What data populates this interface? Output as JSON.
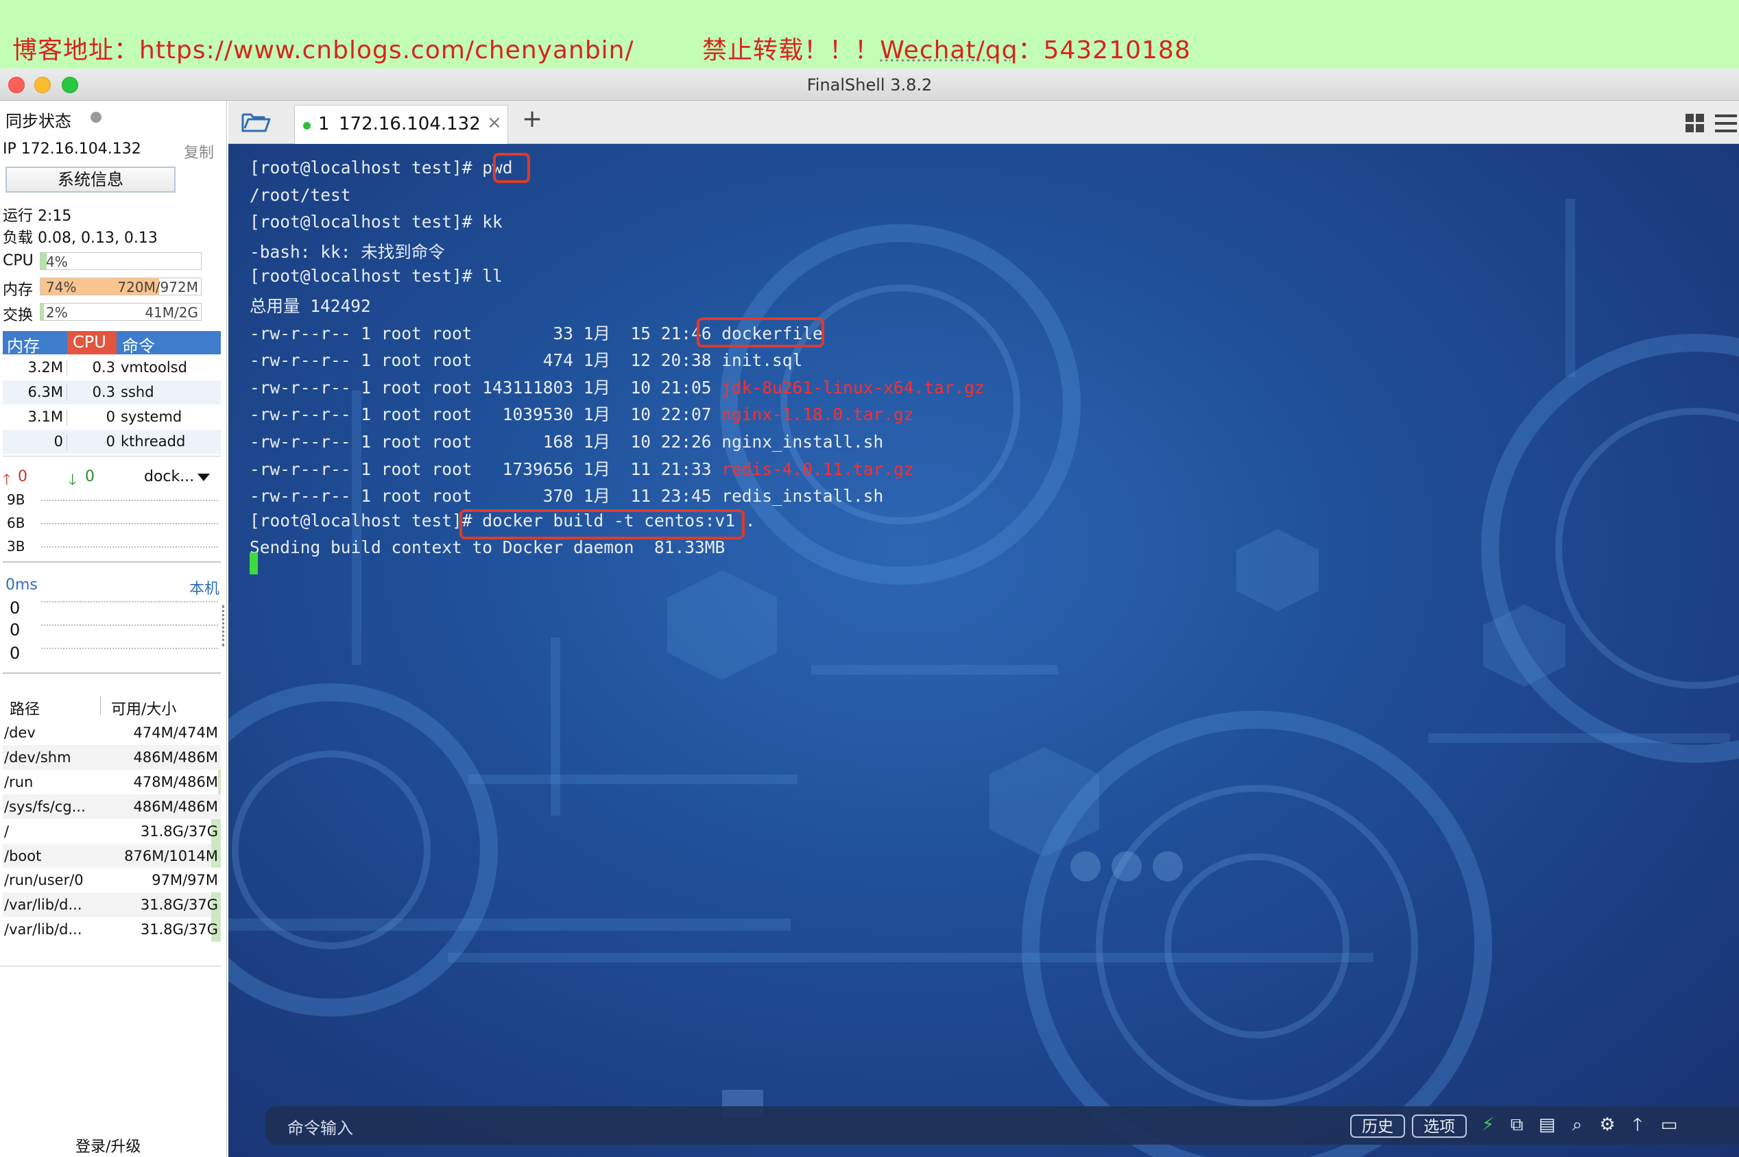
{
  "banner": {
    "prefix": "博客地址：https://www.cnblogs.com/chenyanbin/",
    "gap": "        ",
    "notice": "禁止转载！！！",
    "contact_label": "Wechat/qq",
    "contact_value": "：543210188"
  },
  "window": {
    "title": "FinalShell 3.8.2"
  },
  "sidebar": {
    "sync_label": "同步状态",
    "ip_label": "IP 172.16.104.132",
    "copy_label": "复制",
    "sysinfo_button": "系统信息",
    "uptime": "运行 2:15",
    "load": "负载 0.08, 0.13, 0.13",
    "cpu": {
      "label": "CPU",
      "text": "4%",
      "fraction": 0.04
    },
    "mem": {
      "label": "内存",
      "percent": "74%",
      "usage": "720M/972M",
      "fraction": 0.74
    },
    "swap": {
      "label": "交换",
      "percent": "2%",
      "usage": "41M/2G",
      "fraction": 0.02
    },
    "proc_headers": [
      "内存",
      "CPU",
      "命令"
    ],
    "processes": [
      {
        "mem": "3.2M",
        "cpu": "0.3",
        "cmd": "vmtoolsd"
      },
      {
        "mem": "6.3M",
        "cpu": "0.3",
        "cmd": "sshd"
      },
      {
        "mem": "3.1M",
        "cpu": "0",
        "cmd": "systemd"
      },
      {
        "mem": "0",
        "cpu": "0",
        "cmd": "kthreadd"
      }
    ],
    "net": {
      "up": "0",
      "down": "0",
      "iface": "dock...",
      "scale": [
        "9B",
        "6B",
        "3B"
      ]
    },
    "ping": {
      "ms": "0ms",
      "host": "本机",
      "values": [
        "0",
        "0",
        "0"
      ]
    },
    "disk_headers": [
      "路径",
      "可用/大小"
    ],
    "disks": [
      {
        "path": "/dev",
        "size": "474M/474M",
        "usage": 0.0
      },
      {
        "path": "/dev/shm",
        "size": "486M/486M",
        "usage": 0.0
      },
      {
        "path": "/run",
        "size": "478M/486M",
        "usage": 0.02
      },
      {
        "path": "/sys/fs/cg...",
        "size": "486M/486M",
        "usage": 0.0
      },
      {
        "path": "/",
        "size": "31.8G/37G",
        "usage": 0.14
      },
      {
        "path": "/boot",
        "size": "876M/1014M",
        "usage": 0.14
      },
      {
        "path": "/run/user/0",
        "size": "97M/97M",
        "usage": 0.0
      },
      {
        "path": "/var/lib/d...",
        "size": "31.8G/37G",
        "usage": 0.14
      },
      {
        "path": "/var/lib/d...",
        "size": "31.8G/37G",
        "usage": 0.14
      }
    ],
    "login_label": "登录/升级"
  },
  "tabs": [
    {
      "index": "1",
      "label": "172.16.104.132",
      "close": "×"
    }
  ],
  "add_tab": "+",
  "terminal": {
    "lines": [
      {
        "prompt": "[root@localhost test]# ",
        "cmd": "pwd"
      },
      {
        "text": "/root/test"
      },
      {
        "prompt": "[root@localhost test]# ",
        "cmd": "kk"
      },
      {
        "text": "-bash: kk: 未找到命令"
      },
      {
        "prompt": "[root@localhost test]# ",
        "cmd": "ll"
      },
      {
        "text": "总用量 142492"
      },
      {
        "meta": "-rw-r--r-- 1 root root        33 1月  15 21:46 ",
        "file": "dockerfile",
        "archive": false
      },
      {
        "meta": "-rw-r--r-- 1 root root       474 1月  12 20:38 ",
        "file": "init.sql",
        "archive": false
      },
      {
        "meta": "-rw-r--r-- 1 root root 143111803 1月  10 21:05 ",
        "file": "jdk-8u261-linux-x64.tar.gz",
        "archive": true
      },
      {
        "meta": "-rw-r--r-- 1 root root   1039530 1月  10 22:07 ",
        "file": "nginx-1.18.0.tar.gz",
        "archive": true
      },
      {
        "meta": "-rw-r--r-- 1 root root       168 1月  10 22:26 ",
        "file": "nginx_install.sh",
        "archive": false
      },
      {
        "meta": "-rw-r--r-- 1 root root   1739656 1月  11 21:33 ",
        "file": "redis-4.0.11.tar.gz",
        "archive": true
      },
      {
        "meta": "-rw-r--r-- 1 root root       370 1月  11 23:45 ",
        "file": "redis_install.sh",
        "archive": false
      },
      {
        "prompt": "[root@localhost test]# ",
        "cmd": "docker build -t centos:v1 ."
      },
      {
        "text": "Sending build context to Docker daemon  81.33MB"
      }
    ],
    "archive_color": "#ff2e2e"
  },
  "command_bar": {
    "placeholder": "命令输入",
    "history_button": "历史",
    "options_button": "选项"
  },
  "colors": {
    "accent": "#3e7ccc",
    "highlight_box": "#e03a2a",
    "banner_bg": "#c2ffb5",
    "banner_text": "#d8231c"
  }
}
